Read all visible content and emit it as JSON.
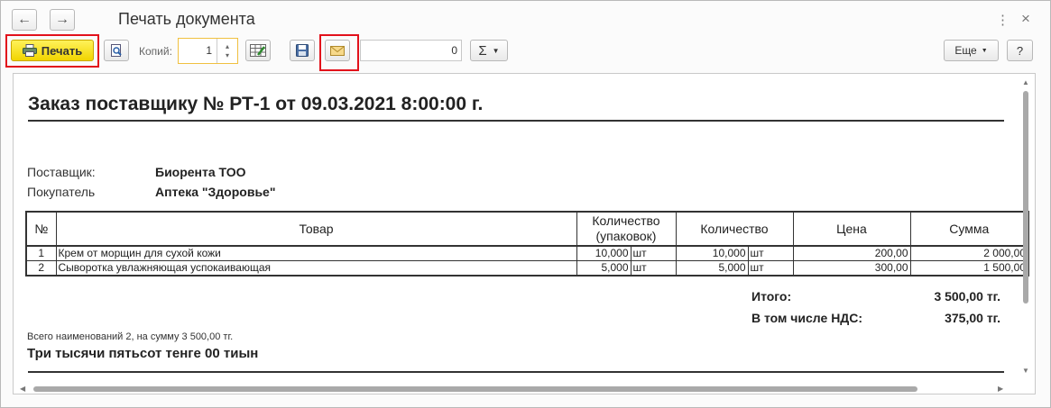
{
  "window": {
    "title": "Печать документа",
    "back_icon": "←",
    "forward_icon": "→",
    "menu_icon": "⋮",
    "close_icon": "×"
  },
  "toolbar": {
    "print_label": "Печать",
    "copies_label": "Копий:",
    "copies_value": "1",
    "sum_value": "0",
    "sigma_label": "Σ",
    "more_label": "Еще",
    "help_label": "?"
  },
  "document": {
    "title": "Заказ поставщику № РТ-1 от 09.03.2021 8:00:00 г.",
    "supplier_label": "Поставщик:",
    "supplier_value": "Биорента ТОО",
    "buyer_label": "Покупатель",
    "buyer_value": "Аптека \"Здоровье\"",
    "table": {
      "headers": {
        "num": "№",
        "product": "Товар",
        "qty_packs": "Количество (упаковок)",
        "qty": "Количество",
        "price": "Цена",
        "sum": "Сумма"
      },
      "rows": [
        {
          "num": "1",
          "product": "Крем от морщин для сухой кожи",
          "qty_packs": "10,000",
          "unit1": "шт",
          "qty": "10,000",
          "unit2": "шт",
          "price": "200,00",
          "sum": "2 000,00"
        },
        {
          "num": "2",
          "product": "Сыворотка увлажняющая успокаивающая",
          "qty_packs": "5,000",
          "unit1": "шт",
          "qty": "5,000",
          "unit2": "шт",
          "price": "300,00",
          "sum": "1 500,00"
        }
      ]
    },
    "total_label": "Итого:",
    "total_value": "3 500,00 тг.",
    "vat_label": "В том числе НДС:",
    "vat_value": "375,00 тг.",
    "summary_note": "Всего наименований 2, на сумму 3 500,00 тг.",
    "amount_words": "Три тысячи пятьсот тенге 00 тиын"
  },
  "colors": {
    "highlight": "#e2111b",
    "print_button": "#f5dc1a"
  }
}
